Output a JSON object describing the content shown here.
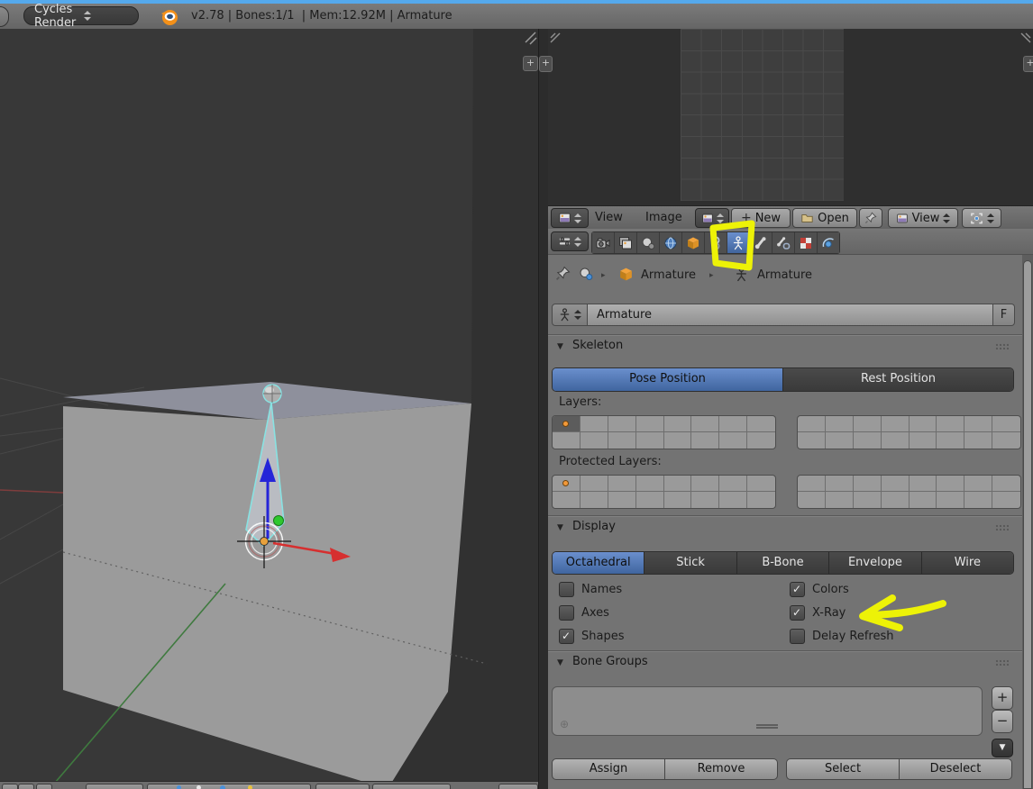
{
  "info_bar": {
    "engine": "Cycles Render",
    "stats": "v2.78 | Bones:1/1  | Mem:12.92M | Armature"
  },
  "image_editor": {
    "menu_view": "View",
    "menu_image": "Image",
    "new_button": "New",
    "open_button": "Open",
    "view_dropdown": "View",
    "icons": [
      "image-editor-icon",
      "plus-icon",
      "open-folder-icon",
      "pin-icon",
      "view-image-icon",
      "pivot-icon"
    ]
  },
  "properties": {
    "tabs": {
      "icons": [
        "render-icon",
        "render-layers-icon",
        "scene-icon",
        "world-icon",
        "object-icon",
        "constraints-icon",
        "armature-data-icon",
        "bone-icon",
        "bone-constraints-icon",
        "texture-icon",
        "physics-icon"
      ],
      "selected": "armature-data-icon"
    },
    "breadcrumb": {
      "object_name": "Armature",
      "data_name": "Armature"
    },
    "id_block": {
      "name": "Armature",
      "fake_user_label": "F"
    },
    "skeleton": {
      "title": "Skeleton",
      "pose_position": "Pose Position",
      "rest_position": "Rest Position",
      "active_position": "Pose Position",
      "layers_label": "Layers:",
      "protected_layers_label": "Protected Layers:",
      "layer_blocks": [
        {
          "active_cell": 0,
          "dot_cell": 0
        },
        {},
        {
          "dot_cell": 0
        },
        {}
      ]
    },
    "display": {
      "title": "Display",
      "modes": [
        "Octahedral",
        "Stick",
        "B-Bone",
        "Envelope",
        "Wire"
      ],
      "selected_mode": "Octahedral",
      "checkboxes": {
        "names": {
          "label": "Names",
          "checked": false
        },
        "axes": {
          "label": "Axes",
          "checked": false
        },
        "shapes": {
          "label": "Shapes",
          "checked": true
        },
        "colors": {
          "label": "Colors",
          "checked": true
        },
        "xray": {
          "label": "X-Ray",
          "checked": true
        },
        "delay_refresh": {
          "label": "Delay Refresh",
          "checked": false
        }
      }
    },
    "bone_groups": {
      "title": "Bone Groups",
      "assign": "Assign",
      "remove": "Remove",
      "select": "Select",
      "deselect": "Deselect"
    }
  },
  "annotations": {
    "highlight_color": "#edf207",
    "highlighted_tab": "armature-data-icon",
    "arrow_target": "X-Ray"
  },
  "colors": {
    "top_strip": "#55a9ec",
    "selected_button_blue": "#5c83c4",
    "viewport_bg": "#383838",
    "panel_bg": "#737373",
    "bone_outline": "#88e2e2",
    "axis_x": "#d62f2f",
    "axis_y": "#3f7a3f",
    "axis_z": "#2525d8"
  }
}
